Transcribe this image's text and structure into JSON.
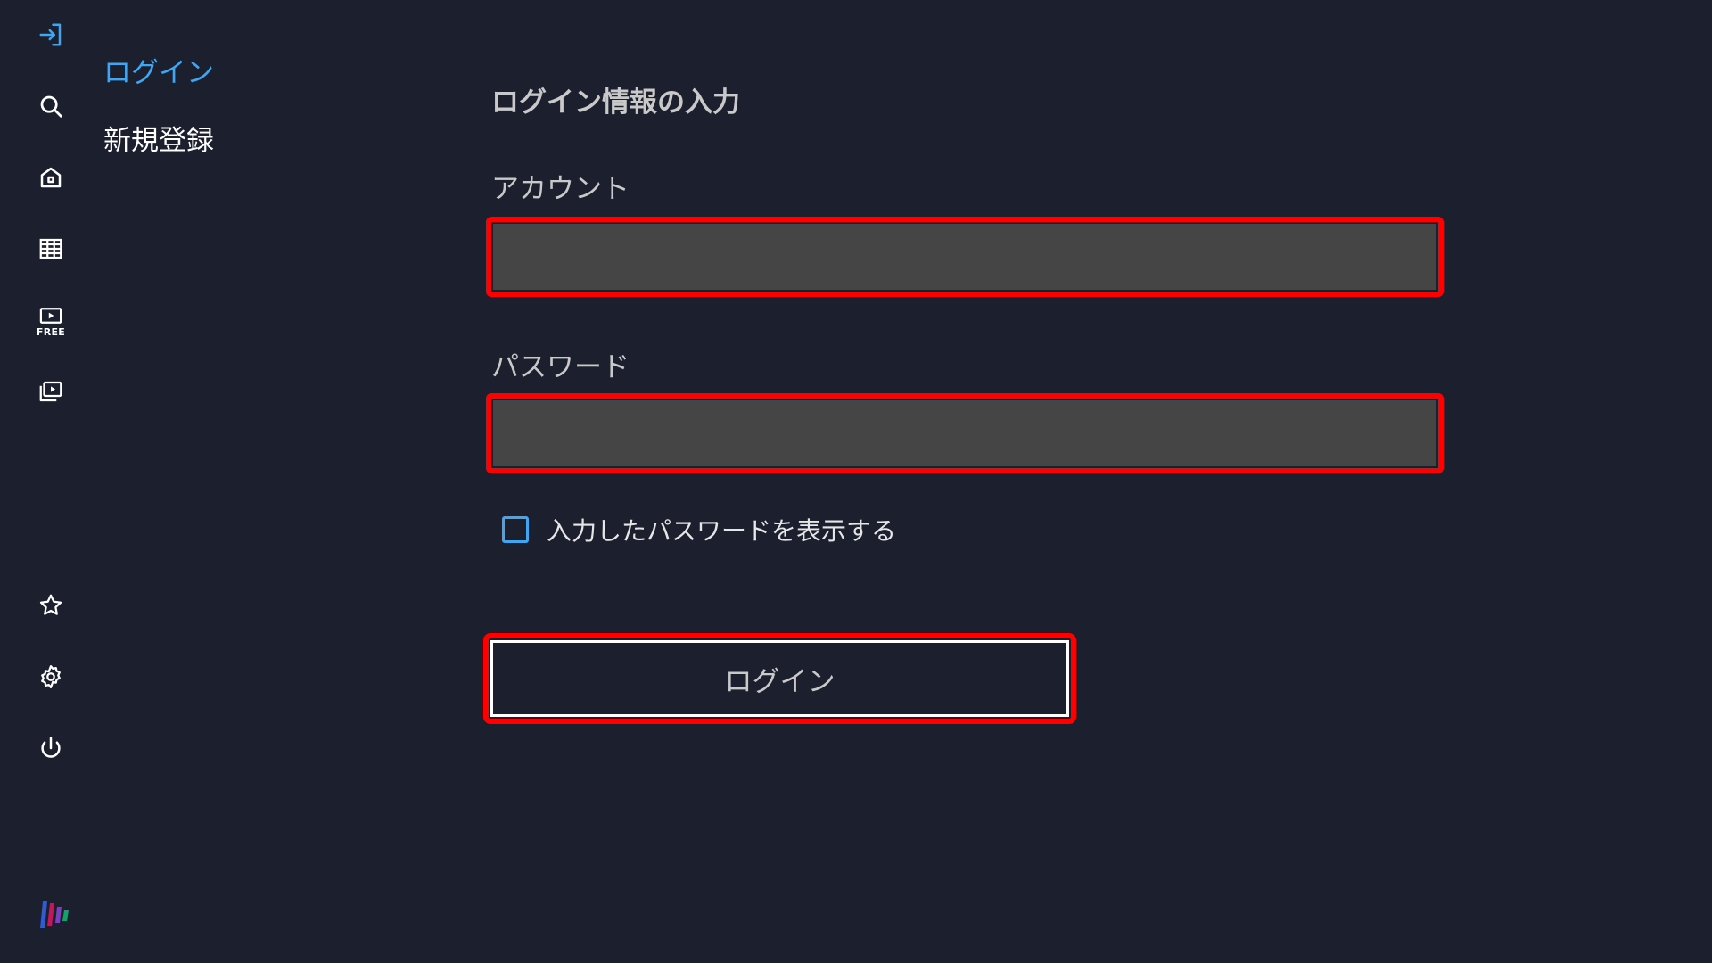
{
  "rail": {
    "items": [
      {
        "icon": "login-icon"
      },
      {
        "icon": "search-icon"
      },
      {
        "icon": "home-icon"
      },
      {
        "icon": "grid-icon"
      },
      {
        "icon": "free-play-icon",
        "label": "FREE"
      },
      {
        "icon": "video-library-icon"
      },
      {
        "icon": "star-icon"
      },
      {
        "icon": "gear-icon"
      },
      {
        "icon": "power-icon"
      }
    ],
    "logo": "brand-logo"
  },
  "subnav": {
    "login": "ログイン",
    "register": "新規登録"
  },
  "form": {
    "title": "ログイン情報の入力",
    "account_label": "アカウント",
    "account_value": "",
    "password_label": "パスワード",
    "password_value": "",
    "show_password_label": "入力したパスワードを表示する",
    "show_password_checked": false,
    "submit_label": "ログイン"
  },
  "colors": {
    "background": "#1b1f2e",
    "accent": "#3ea6f3",
    "highlight": "#ff0000",
    "input_bg": "#454545"
  }
}
